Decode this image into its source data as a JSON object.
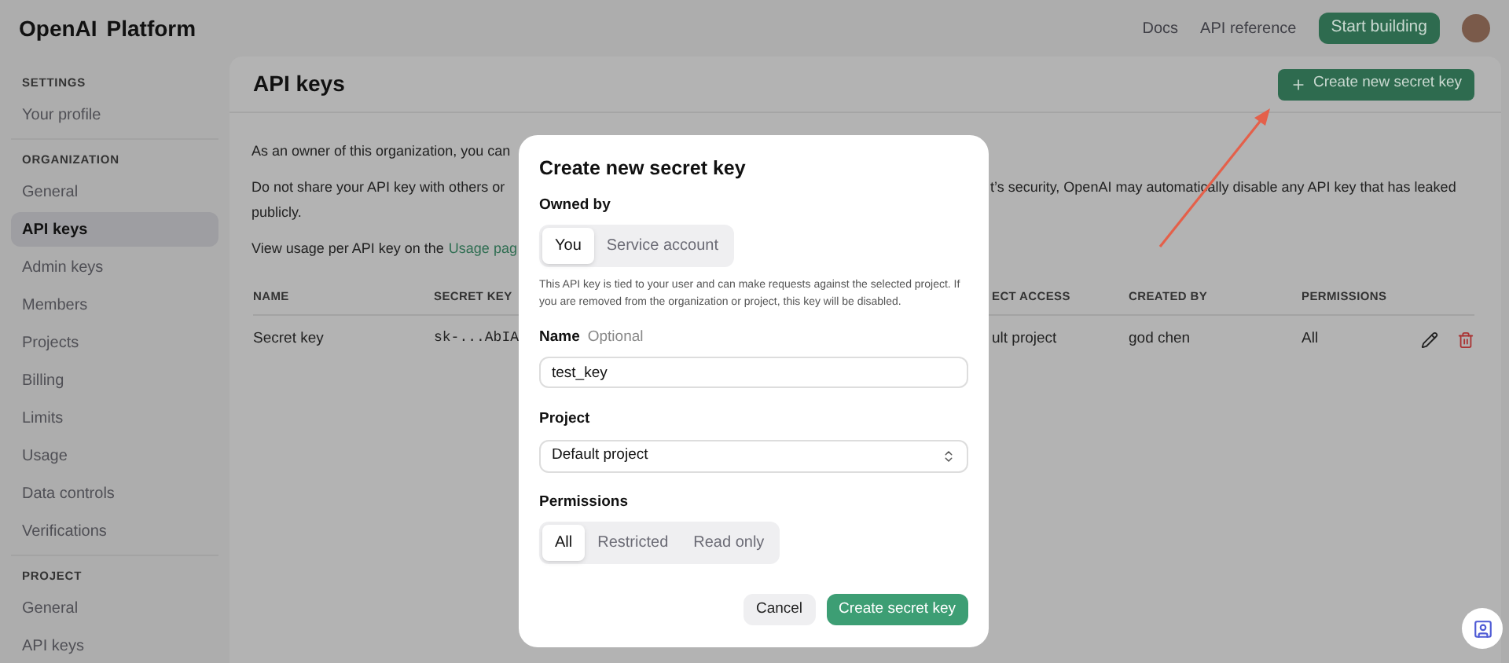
{
  "top_bar": {
    "logo": "OpenAI",
    "product": "Platform",
    "links": [
      "Docs",
      "API reference"
    ],
    "primary_button": "Start building"
  },
  "sidebar": {
    "sections": [
      {
        "heading": "SETTINGS",
        "items": [
          {
            "label": "Your profile",
            "selected": false
          }
        ]
      },
      {
        "heading": "ORGANIZATION",
        "items": [
          {
            "label": "General",
            "selected": false
          },
          {
            "label": "API keys",
            "selected": true
          },
          {
            "label": "Admin keys",
            "selected": false
          },
          {
            "label": "Members",
            "selected": false
          },
          {
            "label": "Projects",
            "selected": false
          },
          {
            "label": "Billing",
            "selected": false
          },
          {
            "label": "Limits",
            "selected": false
          },
          {
            "label": "Usage",
            "selected": false
          },
          {
            "label": "Data controls",
            "selected": false
          },
          {
            "label": "Verifications",
            "selected": false
          }
        ]
      },
      {
        "heading": "PROJECT",
        "items": [
          {
            "label": "General",
            "selected": false
          },
          {
            "label": "API keys",
            "selected": false
          }
        ]
      }
    ]
  },
  "page": {
    "title": "API keys",
    "create_button": "Create new secret key",
    "intro": [
      {
        "left": "As an owner of this organization, you can"
      },
      {
        "left": "Do not share your API key with others or",
        "right": "t’s security, OpenAI may automatically disable any API key that has leaked",
        "continuation": "publicly."
      },
      {
        "left": "View usage per API key on the",
        "link": "Usage pag"
      }
    ],
    "table": {
      "columns": [
        "NAME",
        "SECRET KEY",
        "ECT ACCESS",
        "CREATED BY",
        "PERMISSIONS"
      ],
      "rows": [
        {
          "cells": [
            "Secret key",
            "sk-...AbIA",
            "ult project",
            "god chen",
            "All"
          ]
        }
      ]
    }
  },
  "dialog": {
    "title": "Create new secret key",
    "owned_by": {
      "label": "Owned by",
      "options": [
        {
          "label": "You",
          "selected": true
        },
        {
          "label": "Service account",
          "selected": false
        }
      ]
    },
    "note": "This API key is tied to your user and can make requests against the selected project. If you are removed from the organization or project, this key will be disabled.",
    "name": {
      "label": "Name",
      "hint": "Optional",
      "value": "test_key"
    },
    "project": {
      "label": "Project",
      "value": "Default project"
    },
    "permissions": {
      "label": "Permissions",
      "options": [
        {
          "label": "All",
          "selected": true
        },
        {
          "label": "Restricted",
          "selected": false
        },
        {
          "label": "Read only",
          "selected": false
        }
      ]
    },
    "buttons": [
      {
        "label": "Cancel",
        "kind": "secondary"
      },
      {
        "label": "Create secret key",
        "kind": "primary"
      }
    ]
  }
}
